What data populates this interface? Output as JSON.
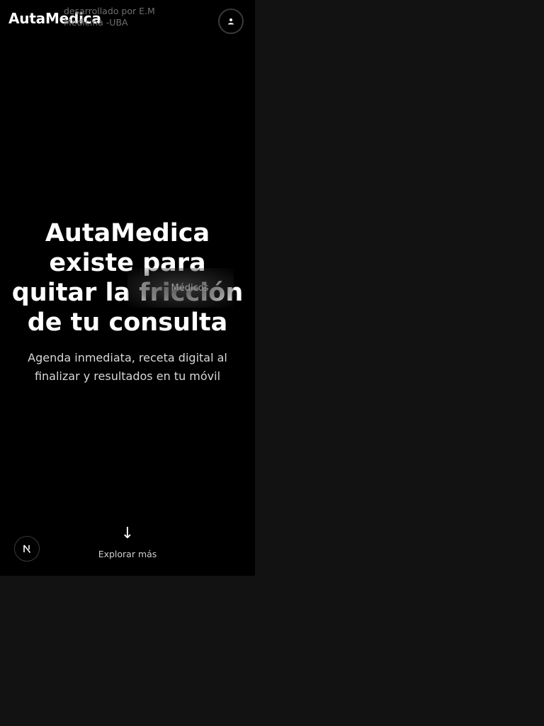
{
  "header": {
    "brand": "AutaMedica",
    "credit": "desarrollado por E.M Medicina -UBA",
    "user_icon": "user-icon"
  },
  "hero": {
    "title_lines": [
      "AutaMedica",
      "existe para",
      "quitar la fricción",
      "de tu consulta"
    ],
    "overlay_tag": "Médicos",
    "subtitle": "Agenda inmediata, receta digital al finalizar y resultados en tu móvil"
  },
  "explore": {
    "arrow": "↓",
    "label": "Explorar más"
  },
  "badge": {
    "icon": "nextjs-logo-icon"
  },
  "colors": {
    "background": "#121212",
    "phone_bg": "#000000",
    "text": "#ffffff",
    "muted": "#6e6e6e"
  }
}
